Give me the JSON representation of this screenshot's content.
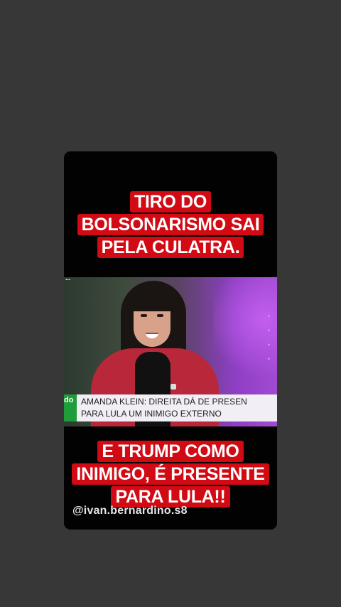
{
  "top_caption": {
    "lines": [
      "TIRO DO",
      "BOLSONARISMO SAI",
      "PELA CULATRA."
    ]
  },
  "video": {
    "channel_logo": "...",
    "lower_third": {
      "tag": "do",
      "lines": [
        "AMANDA KLEIN: DIREITA DÁ DE PRESEN",
        "PARA LULA UM INIMIGO EXTERNO"
      ]
    }
  },
  "bottom_caption": {
    "lines": [
      "E TRUMP COMO",
      "INIMIGO, É PRESENTE",
      "PARA LULA!!"
    ]
  },
  "watermark": "@ivan.bernardino.s8",
  "colors": {
    "background": "#373737",
    "caption_red": "#d10a14",
    "card": "#020202",
    "purple_accent": "#a14ad2",
    "green_tag": "#1f9d3a"
  }
}
